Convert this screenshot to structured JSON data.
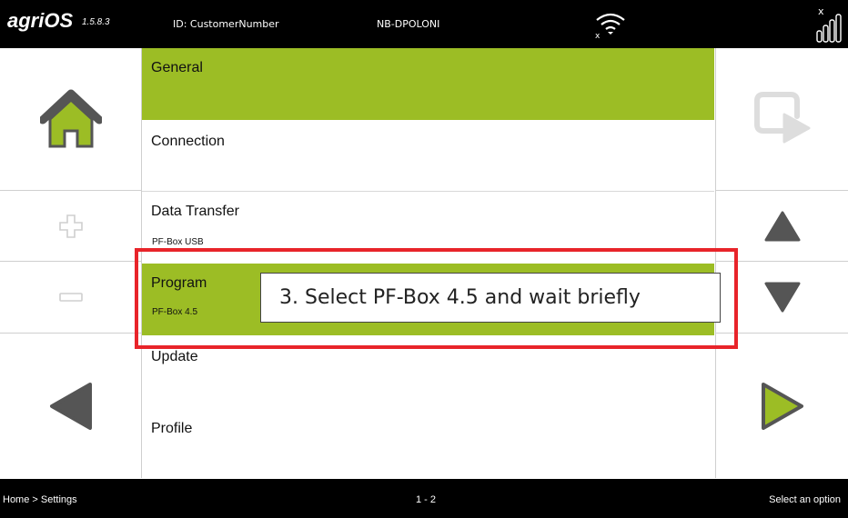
{
  "header": {
    "logo": "agriOS",
    "version": "1.5.8.3",
    "customer_id": "ID: CustomerNumber",
    "device": "NB-DPOLONI",
    "wifi_icon": "wifi-disconnected-icon",
    "signal_icon": "signal-strength-icon"
  },
  "left_buttons": [
    "home-button",
    "plus-button",
    "minus-button",
    "back-button"
  ],
  "right_buttons": [
    "confirm-button",
    "scroll-up-button",
    "scroll-down-button",
    "forward-button"
  ],
  "menu": {
    "items": [
      {
        "label": "General",
        "sub": "",
        "selected": true
      },
      {
        "label": "Connection",
        "sub": "",
        "selected": false
      },
      {
        "label": "Data Transfer",
        "sub": "PF-Box USB",
        "selected": false
      },
      {
        "label": "Program",
        "sub": "PF-Box 4.5",
        "selected": true
      },
      {
        "label": "Update",
        "sub": "",
        "selected": false
      },
      {
        "label": "Profile",
        "sub": "",
        "selected": false
      }
    ]
  },
  "callout": {
    "text": "3. Select PF-Box 4.5 and wait briefly"
  },
  "footer": {
    "breadcrumb": "Home > Settings",
    "page": "1 - 2",
    "status": "Select an option"
  },
  "colors": {
    "accent": "#9cbd25",
    "highlight": "#e8242a",
    "bar": "#000000",
    "icon_gray": "#555555"
  }
}
